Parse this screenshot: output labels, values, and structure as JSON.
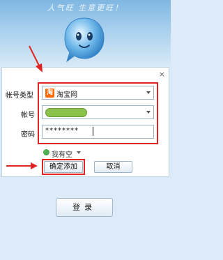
{
  "banner": {
    "slogan": "人气旺  生意更旺！"
  },
  "dialog": {
    "close_label": "×",
    "account_type": {
      "label": "帐号类型",
      "logo_text": "淘",
      "value": "淘宝网"
    },
    "account": {
      "label": "帐号"
    },
    "password": {
      "label": "密码",
      "value": "********"
    },
    "status": {
      "label": "我有空"
    },
    "confirm_label": "确定添加",
    "cancel_label": "取消"
  },
  "login": {
    "label": "登录"
  },
  "colors": {
    "annotation": "#e02424",
    "status_online": "#4caf50",
    "redacted_pill": "#8bc34a"
  }
}
